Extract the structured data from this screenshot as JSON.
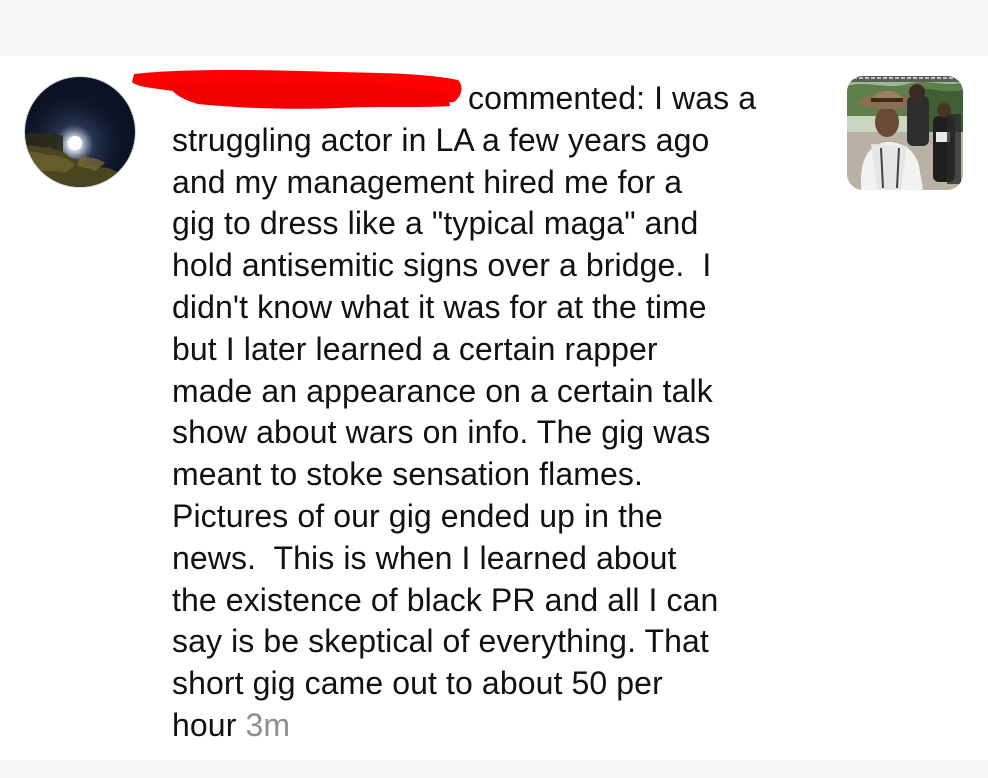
{
  "comment": {
    "lines": [
      "commented: I was a",
      "struggling actor in LA a few years ago",
      "and my management hired me for a",
      "gig to dress like a \"typical maga\" and",
      "hold antisemitic signs over a bridge.  I",
      "didn't know what it was for at the time",
      "but I later learned a certain rapper",
      "made an appearance on a certain talk",
      "show about wars on info. The gig was",
      "meant to stoke sensation flames.",
      "Pictures of our gig ended up in the",
      "news.  This is when I learned about",
      "the existence of black PR and all I can",
      "say is be skeptical of everything. That",
      "short gig came out to about 50 per"
    ],
    "last_line": "hour",
    "timestamp": "3m"
  },
  "colors": {
    "text": "#111111",
    "timestamp": "#8e8e93",
    "redaction": "#ff0000",
    "background": "#ffffff",
    "bars": "#f7f7f7"
  },
  "icons": {
    "avatar": "night-moon-avatar",
    "thumbnail": "post-thumbnail-photo"
  }
}
